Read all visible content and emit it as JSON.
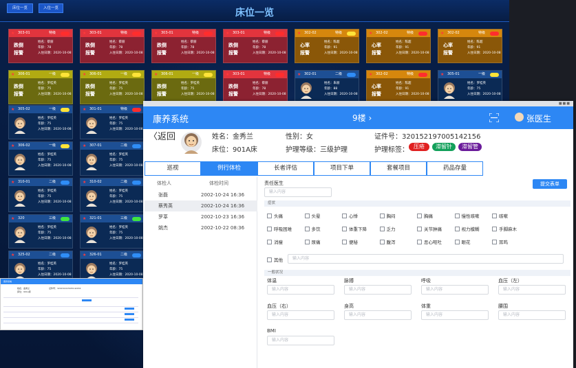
{
  "dashboard": {
    "title": "床位一览",
    "buttons": [
      "床位一览",
      "入住一览"
    ],
    "rows": [
      [
        {
          "room": "303-01",
          "level": "特级",
          "pill": "red",
          "theme": "red",
          "alarm": "跌倒报警",
          "name": "姓名：蔡丽",
          "age": "年龄：78",
          "date": "入住日期：2020-10-08"
        },
        {
          "room": "303-01",
          "level": "特级",
          "pill": "red",
          "theme": "red",
          "alarm": "跌倒报警",
          "name": "姓名：蔡丽",
          "age": "年龄：78",
          "date": "入住日期：2020-10-08"
        },
        {
          "room": "303-01",
          "level": "特级",
          "pill": "red",
          "theme": "red",
          "alarm": "跌倒报警",
          "name": "姓名：蔡丽",
          "age": "年龄：78",
          "date": "入住日期：2020-10-08"
        },
        {
          "room": "303-01",
          "level": "特级",
          "pill": "red",
          "theme": "red",
          "alarm": "跌倒报警",
          "name": "姓名：蔡丽",
          "age": "年龄：78",
          "date": "入住日期：2020-10-08"
        },
        {
          "room": "302-02",
          "level": "特级",
          "pill": "yellow",
          "theme": "orange",
          "alarm": "心率报警",
          "name": "姓名：陈超",
          "age": "年龄：91",
          "date": "入住日期：2020-10-08"
        },
        {
          "room": "302-02",
          "level": "特级",
          "pill": "red",
          "theme": "orange",
          "alarm": "心率报警",
          "name": "姓名：陈超",
          "age": "年龄：91",
          "date": "入住日期：2020-10-08"
        },
        {
          "room": "302-02",
          "level": "特级",
          "pill": "red",
          "theme": "orange",
          "alarm": "心率报警",
          "name": "姓名：陈超",
          "age": "年龄：91",
          "date": "入住日期：2020-10-08"
        }
      ],
      [
        {
          "room": "306-01",
          "level": "一级",
          "pill": "yellow",
          "theme": "olive",
          "alarm": "跌倒报警",
          "name": "姓名：罗桂英",
          "age": "年龄：75",
          "date": "入住日期：2020-10-08"
        },
        {
          "room": "306-01",
          "level": "一级",
          "pill": "yellow",
          "theme": "olive",
          "alarm": "跌倒报警",
          "name": "姓名：罗桂英",
          "age": "年龄：75",
          "date": "入住日期：2020-10-08"
        },
        {
          "room": "306-01",
          "level": "一级",
          "pill": "yellow",
          "theme": "olive",
          "alarm": "跌倒报警",
          "name": "姓名：罗桂英",
          "age": "年龄：75",
          "date": "入住日期：2020-10-08"
        },
        {
          "room": "303-01",
          "level": "特级",
          "pill": "red",
          "theme": "red",
          "alarm": "跌倒报警",
          "name": "姓名：蔡丽",
          "age": "年龄：78",
          "date": "入住日期：2020-10-08"
        },
        {
          "room": "302-01",
          "level": "二级",
          "pill": "blue",
          "theme": "navy",
          "alarm": "",
          "name": "姓名：朱丽",
          "age": "年龄：88",
          "date": "入住日期：2020-10-08",
          "face": true
        },
        {
          "room": "302-02",
          "level": "特级",
          "pill": "red",
          "theme": "orange",
          "alarm": "心率报警",
          "name": "姓名：陈超",
          "age": "年龄：91",
          "date": "入住日期：2020-10-08"
        },
        {
          "room": "305-01",
          "level": "一级",
          "pill": "yellow",
          "theme": "navy",
          "alarm": "",
          "name": "姓名：罗桂英",
          "age": "年龄：75",
          "date": "入住日期：2020-10-08",
          "face": true
        }
      ],
      [
        {
          "room": "305-02",
          "level": "一级",
          "pill": "yellow",
          "theme": "navy",
          "name": "姓名：罗桂英",
          "age": "年龄：75",
          "date": "入住日期：2020-10-08",
          "face": true
        },
        {
          "room": "301-01",
          "level": "特级",
          "pill": "red",
          "theme": "navy",
          "name": "姓名：罗桂英",
          "age": "年龄：75",
          "date": "入住日期：2020-10-08",
          "face": true
        }
      ],
      [
        {
          "room": "306-02",
          "level": "一级",
          "pill": "yellow",
          "theme": "navy",
          "name": "姓名：罗桂英",
          "age": "年龄：75",
          "date": "入住日期：2020-10-08",
          "face": true
        },
        {
          "room": "307-01",
          "level": "二级",
          "pill": "blue",
          "theme": "navy",
          "name": "姓名：罗桂英",
          "age": "年龄：75",
          "date": "入住日期：2020-10-08",
          "face": true
        }
      ],
      [
        {
          "room": "310-01",
          "level": "二级",
          "pill": "blue",
          "theme": "navy",
          "name": "姓名：罗桂英",
          "age": "年龄：75",
          "date": "入住日期：2020-10-08",
          "face": true
        },
        {
          "room": "310-02",
          "level": "二级",
          "pill": "blue",
          "theme": "navy",
          "name": "姓名：罗桂英",
          "age": "年龄：75",
          "date": "入住日期：2020-10-08",
          "face": true
        }
      ],
      [
        {
          "room": "320",
          "level": "三级",
          "pill": "green",
          "theme": "navy",
          "name": "姓名：罗桂英",
          "age": "年龄：75",
          "date": "入住日期：2020-10-08",
          "face": true
        },
        {
          "room": "321-01",
          "level": "三级",
          "pill": "green",
          "theme": "navy",
          "name": "姓名：罗桂英",
          "age": "年龄：75",
          "date": "入住日期：2020-10-08",
          "face": true
        }
      ],
      [
        {
          "room": "325-02",
          "level": "二级",
          "pill": "blue",
          "theme": "navy",
          "name": "姓名：罗桂英",
          "age": "年龄：75",
          "date": "入住日期：2020-10-08",
          "face": true
        },
        {
          "room": "326-01",
          "level": "二级",
          "pill": "blue",
          "theme": "navy",
          "name": "姓名：罗桂英",
          "age": "年龄：75",
          "date": "入住日期：2020-10-08",
          "face": true
        }
      ]
    ]
  },
  "app": {
    "name": "康养系统",
    "floor": "9楼",
    "floor_arrow": "›",
    "doctor": "张医生",
    "back": "返回",
    "patient": {
      "name": "姓名：金秀兰",
      "gender": "性别：女",
      "id": "证件号：320152197005142156",
      "bed": "床位：901A床",
      "care": "护理等级：三级护理",
      "tags_label": "护理标签：",
      "tags": [
        {
          "text": "压疮",
          "color": "#e02020"
        },
        {
          "text": "滞留针",
          "color": "#12a05a"
        },
        {
          "text": "滞留管",
          "color": "#6a1b9a"
        }
      ]
    },
    "tabs": [
      "巡视",
      "例行体检",
      "长者评估",
      "项目下单",
      "套餐项目",
      "药品存量"
    ],
    "active_tab": 1,
    "history": {
      "col_person": "体检人",
      "col_time": "体检时间",
      "rows": [
        {
          "name": "张磊",
          "time": "2002-10-24 16:36"
        },
        {
          "name": "蔡秀英",
          "time": "2002-10-24 16:36"
        },
        {
          "name": "罗莘",
          "time": "2002-10-23 16:36"
        },
        {
          "name": "姚杰",
          "time": "2002-10-22 08:36"
        }
      ]
    },
    "form": {
      "doctor_label": "责任医生",
      "placeholder": "输入内容",
      "submit": "提交表单",
      "symptom_section": "症状",
      "symptoms": [
        [
          "头痛",
          "头晕",
          "心悸",
          "胸闷",
          "胸痛",
          "慢性咳嗽",
          "咳嗽"
        ],
        [
          "呼吸困难",
          "多饮",
          "体重下降",
          "乏力",
          "关节肿痛",
          "视力模糊",
          "手脚麻木"
        ],
        [
          "消瘦",
          "尿痛",
          "便秘",
          "腹泻",
          "恶心呕吐",
          "眼花",
          "耳鸣"
        ]
      ],
      "other_label": "其他",
      "general_section": "一般状况",
      "fields": [
        [
          "体温",
          "脉搏",
          "呼吸",
          "血压（左）"
        ],
        [
          "血压（右）",
          "身高",
          "体重",
          "腰围"
        ],
        [
          "BMI"
        ]
      ]
    }
  },
  "colors": {
    "accent": "#2d87f4",
    "dash_bg": "#071a3d",
    "title": "#7ec1ff"
  }
}
